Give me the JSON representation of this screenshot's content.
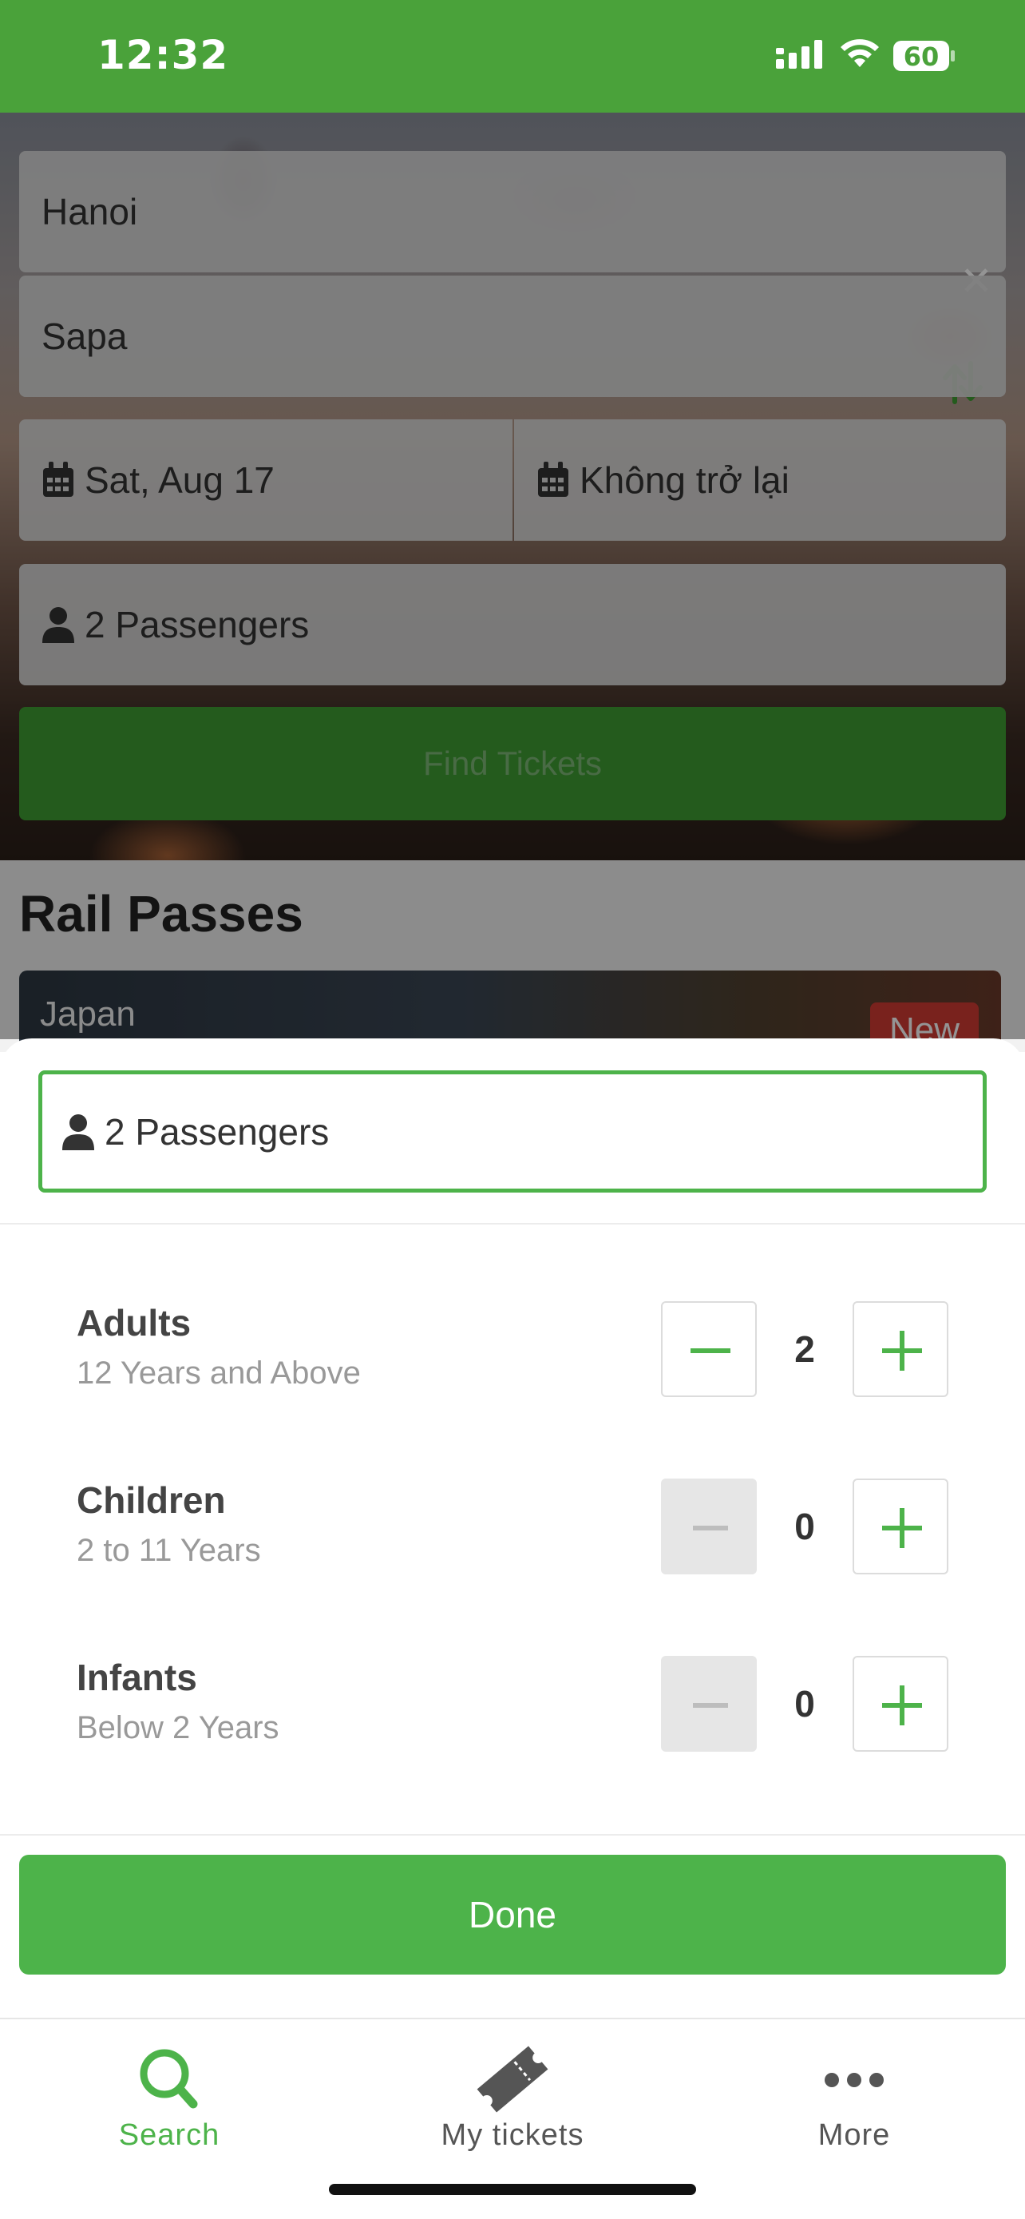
{
  "status_bar": {
    "time": "12:32",
    "battery": "60",
    "icons": [
      "signal-icon",
      "wifi-icon",
      "battery-icon"
    ]
  },
  "search_form": {
    "origin": "Hanoi",
    "destination": "Sapa",
    "depart_date": "Sat, Aug 17",
    "return_date": "Không trở lại",
    "passengers": "2 Passengers",
    "find_button": "Find Tickets",
    "icons": [
      "close-icon",
      "swap-icon",
      "calendar-icon",
      "person-icon"
    ]
  },
  "rail_passes": {
    "title": "Rail Passes",
    "card_label": "Japan",
    "card_badge": "New"
  },
  "passenger_sheet": {
    "summary": "2 Passengers",
    "rows": [
      {
        "name": "Adults",
        "description": "12 Years and Above",
        "count": "2",
        "minus_enabled": true
      },
      {
        "name": "Children",
        "description": "2 to 11 Years",
        "count": "0",
        "minus_enabled": false
      },
      {
        "name": "Infants",
        "description": "Below 2 Years",
        "count": "0",
        "minus_enabled": false
      }
    ],
    "done_button": "Done"
  },
  "tab_bar": {
    "tabs": [
      {
        "label": "Search",
        "icon": "search-icon",
        "active": true
      },
      {
        "label": "My tickets",
        "icon": "ticket-icon",
        "active": false
      },
      {
        "label": "More",
        "icon": "more-icon",
        "active": false
      }
    ]
  },
  "colors": {
    "brand_green": "#4db34a",
    "status_green": "#4aa23a",
    "badge_red": "#d03b33"
  }
}
